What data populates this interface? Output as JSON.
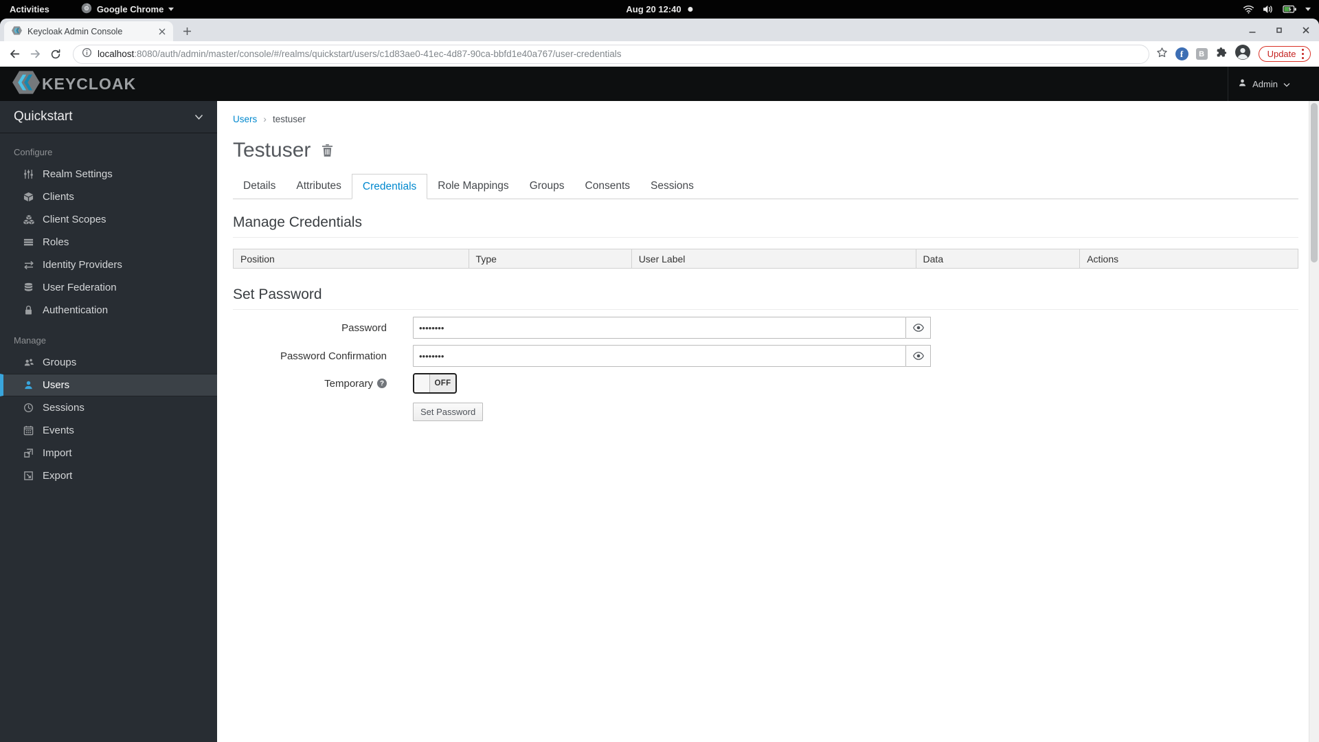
{
  "desktop": {
    "activities_label": "Activities",
    "app_menu_label": "Google Chrome",
    "clock": "Aug 20 12:40"
  },
  "browser": {
    "tab_title": "Keycloak Admin Console",
    "url": {
      "host": "localhost",
      "rest": ":8080/auth/admin/master/console/#/realms/quickstart/users/c1d83ae0-41ec-4d87-90ca-bbfd1e40a767/user-credentials"
    },
    "update_button": "Update"
  },
  "header": {
    "logo": "KEYCLOAK",
    "user": "Admin"
  },
  "sidebar": {
    "realm": "Quickstart",
    "configure": {
      "label": "Configure",
      "items": [
        {
          "label": "Realm Settings",
          "icon": "sliders-icon"
        },
        {
          "label": "Clients",
          "icon": "cube-icon"
        },
        {
          "label": "Client Scopes",
          "icon": "cubes-icon"
        },
        {
          "label": "Roles",
          "icon": "list-icon"
        },
        {
          "label": "Identity Providers",
          "icon": "exchange-icon"
        },
        {
          "label": "User Federation",
          "icon": "database-icon"
        },
        {
          "label": "Authentication",
          "icon": "lock-icon"
        }
      ]
    },
    "manage": {
      "label": "Manage",
      "items": [
        {
          "label": "Groups",
          "icon": "users-icon"
        },
        {
          "label": "Users",
          "icon": "user-icon",
          "active": true
        },
        {
          "label": "Sessions",
          "icon": "clock-icon"
        },
        {
          "label": "Events",
          "icon": "calendar-icon"
        },
        {
          "label": "Import",
          "icon": "import-icon"
        },
        {
          "label": "Export",
          "icon": "export-icon"
        }
      ]
    }
  },
  "main": {
    "breadcrumb": {
      "parent": "Users",
      "current": "testuser"
    },
    "title": "Testuser",
    "tabs": [
      {
        "label": "Details"
      },
      {
        "label": "Attributes"
      },
      {
        "label": "Credentials",
        "active": true
      },
      {
        "label": "Role Mappings"
      },
      {
        "label": "Groups"
      },
      {
        "label": "Consents"
      },
      {
        "label": "Sessions"
      }
    ],
    "credentials": {
      "heading": "Manage Credentials",
      "columns": [
        "Position",
        "Type",
        "User Label",
        "Data",
        "Actions"
      ]
    },
    "password_form": {
      "heading": "Set Password",
      "password": {
        "label": "Password",
        "value": "********"
      },
      "confirmation": {
        "label": "Password Confirmation",
        "value": "********"
      },
      "temporary": {
        "label": "Temporary",
        "state": "OFF"
      },
      "submit": "Set Password"
    }
  },
  "colors": {
    "accent_blue": "#0088ce",
    "sidebar_active_blue": "#39a5dc",
    "update_red": "#c5221f"
  }
}
